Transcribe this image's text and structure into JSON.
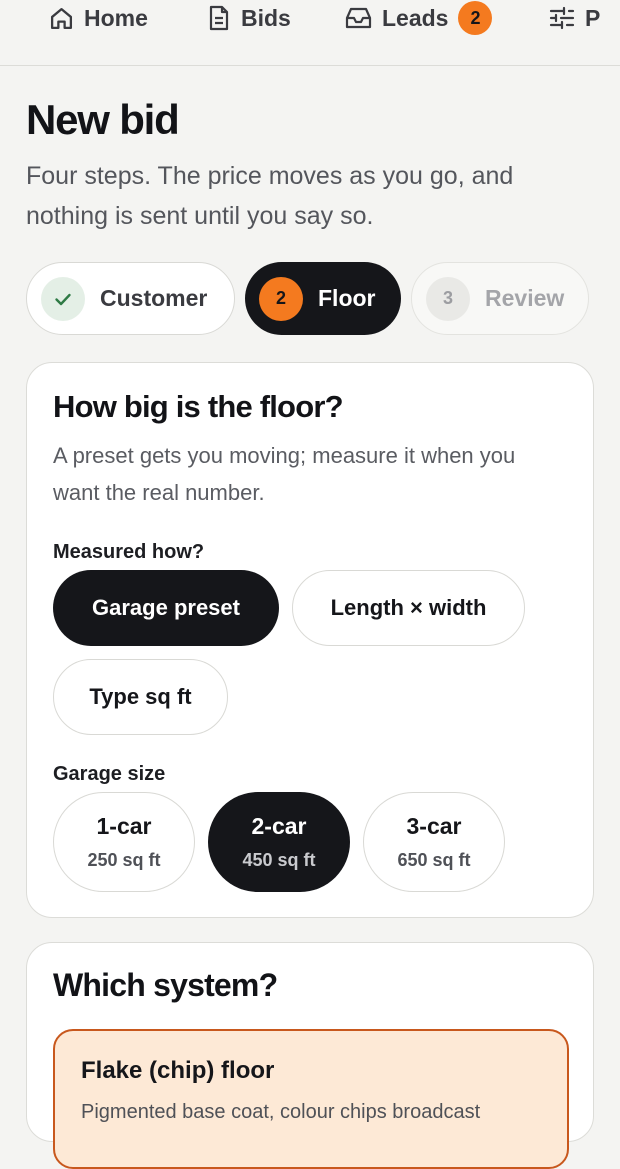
{
  "nav": {
    "items": [
      {
        "label": "Home",
        "icon": "home-icon"
      },
      {
        "label": "Bids",
        "icon": "document-icon"
      },
      {
        "label": "Leads",
        "icon": "inbox-icon",
        "badge": "2"
      },
      {
        "label": "P",
        "icon": "sliders-icon"
      }
    ]
  },
  "header": {
    "title": "New bid",
    "subtitle": "Four steps. The price moves as you go, and nothing is sent until you say so."
  },
  "stepper": {
    "steps": [
      {
        "label": "Customer",
        "marker": "",
        "state": "done"
      },
      {
        "label": "Floor",
        "marker": "2",
        "state": "active"
      },
      {
        "label": "Review",
        "marker": "3",
        "state": "todo"
      }
    ]
  },
  "floor_card": {
    "title": "How big is the floor?",
    "description": "A preset gets you moving; measure it when you want the real number.",
    "method_label": "Measured how?",
    "methods": [
      {
        "label": "Garage preset",
        "selected": true
      },
      {
        "label": "Length × width",
        "selected": false
      },
      {
        "label": "Type sq ft",
        "selected": false
      }
    ],
    "size_label": "Garage size",
    "sizes": [
      {
        "name": "1-car",
        "area": "250 sq ft",
        "selected": false
      },
      {
        "name": "2-car",
        "area": "450 sq ft",
        "selected": true
      },
      {
        "name": "3-car",
        "area": "650 sq ft",
        "selected": false
      }
    ]
  },
  "system_card": {
    "title": "Which system?",
    "options": [
      {
        "name": "Flake (chip) floor",
        "description": "Pigmented base coat, colour chips broadcast"
      }
    ]
  },
  "colors": {
    "accent": "#f47a1f",
    "dark": "#15161a",
    "background": "#f4f4f2",
    "selected_option_bg": "#fde9d6",
    "selected_option_border": "#c8581d",
    "done_circle": "#e4efe6",
    "check": "#2f7a45"
  }
}
